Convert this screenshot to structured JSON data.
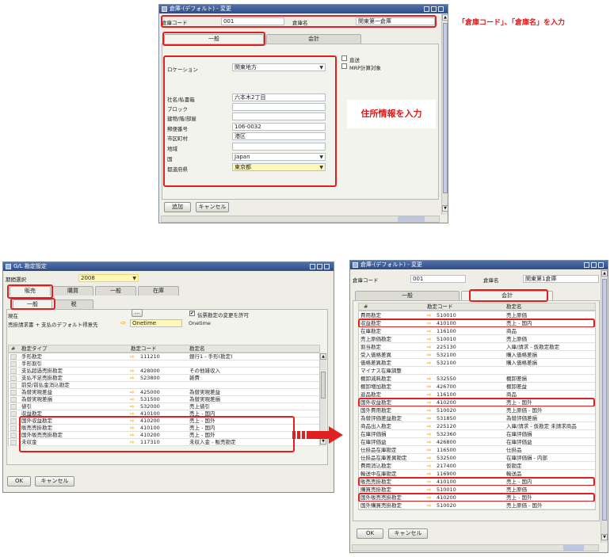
{
  "w1": {
    "title": "倉庫-(デフォルト) - 変更",
    "code_label": "倉庫コード",
    "code_value": "001",
    "name_label": "倉庫名",
    "name_value": "関東第一倉庫",
    "tab_general": "一般",
    "tab_accounting": "会計",
    "location_label": "ロケーション",
    "location_value": "関東地方",
    "chk1": "直送",
    "chk2": "MRP計算対象",
    "fields": [
      {
        "label": "社名/私書箱",
        "value": "六本木2丁目"
      },
      {
        "label": "ブロック",
        "value": ""
      },
      {
        "label": "建物/階/部屋",
        "value": ""
      },
      {
        "label": "郵便番号",
        "value": "106-0032"
      },
      {
        "label": "市区町村",
        "value": "港区"
      },
      {
        "label": "地域",
        "value": ""
      },
      {
        "label": "国",
        "value": "Japan"
      },
      {
        "label": "都道府県",
        "value": "東京都"
      }
    ],
    "add_btn": "追加",
    "cancel_btn": "キャンセル"
  },
  "ann1": "「倉庫コード」、「倉庫名」を入力",
  "ann2": "住所情報を入力",
  "w2": {
    "title": "G/L 勘定設定",
    "period_label": "期間選択",
    "period_value": "2008",
    "tabs": [
      "販売",
      "購買",
      "一般",
      "在庫"
    ],
    "subtabs": [
      "一般",
      "税"
    ],
    "filter_label": "現在",
    "filter_btn": "...",
    "chk_label": "伝票勘定の変更を許可",
    "dflt_label": "売掛請求書 + 支払のデフォルト得意先",
    "dflt_value": "Onetime",
    "dflt_value2": "Onetime",
    "col_type": "勘定タイプ",
    "col_code": "勘定コード",
    "col_name": "勘定名",
    "rows": [
      {
        "type": "手形勘定",
        "code": "111210",
        "name": "銀行1 - 手形(勘定)"
      },
      {
        "type": "手形割引",
        "code": "",
        "name": ""
      },
      {
        "type": "支払超過売掛勘定",
        "code": "428000",
        "name": "その他雑収入"
      },
      {
        "type": "支払不足売掛勘定",
        "code": "523800",
        "name": "雑費"
      },
      {
        "type": "前受/前払金消込勘定",
        "code": "",
        "name": ""
      },
      {
        "type": "為替実現差益",
        "code": "425000",
        "name": "為替実現差益"
      },
      {
        "type": "為替実現差損",
        "code": "531500",
        "name": "為替実現差損"
      },
      {
        "type": "値引",
        "code": "532000",
        "name": "売上値引"
      },
      {
        "type": "収益勘定",
        "code": "410100",
        "name": "売上 - 国内"
      },
      {
        "type": "国外収益勘定",
        "code": "410200",
        "name": "売上 - 国外"
      },
      {
        "type": "販売売掛勘定",
        "code": "410100",
        "name": "売上 - 国内"
      },
      {
        "type": "国外販売売掛勘定",
        "code": "410200",
        "name": "売上 - 国外"
      },
      {
        "type": "未収金",
        "code": "117310",
        "name": "未収入金 - 販売勘定"
      }
    ],
    "ok_btn": "OK",
    "cancel_btn": "キャンセル"
  },
  "w3": {
    "title": "倉庫-(デフォルト) - 変更",
    "code_label": "倉庫コード",
    "code_value": "001",
    "name_label": "倉庫名",
    "name_value": "関東第1倉庫",
    "tab_general": "一般",
    "tab_accounting": "会計",
    "col_num": "#",
    "col_code": "勘定コード",
    "col_name": "勘定名",
    "rows": [
      {
        "type": "費用勘定",
        "code": "510010",
        "name": "売上原価"
      },
      {
        "type": "収益勘定",
        "code": "410100",
        "name": "売上 - 国内"
      },
      {
        "type": "在庫勘定",
        "code": "116100",
        "name": "商品"
      },
      {
        "type": "売上原価勘定",
        "code": "510010",
        "name": "売上原価"
      },
      {
        "type": "割当勘定",
        "code": "225130",
        "name": "入庫/請求 - 仮勘定勘定"
      },
      {
        "type": "受入価格差異",
        "code": "532100",
        "name": "購入価格差損"
      },
      {
        "type": "価格差異勘定",
        "code": "532100",
        "name": "購入価格差損"
      },
      {
        "type": "マイナス在庫調整",
        "code": "",
        "name": ""
      },
      {
        "type": "棚卸減耗勘定",
        "code": "532550",
        "name": "棚卸差損"
      },
      {
        "type": "棚卸増加勘定",
        "code": "426700",
        "name": "棚卸差益"
      },
      {
        "type": "返品勘定",
        "code": "116100",
        "name": "商品"
      },
      {
        "type": "国外収益勘定",
        "code": "410200",
        "name": "売上 - 国外"
      },
      {
        "type": "国外費用勘定",
        "code": "510020",
        "name": "売上原価 - 国外"
      },
      {
        "type": "為替評価差益勘定",
        "code": "531850",
        "name": "為替評価差損"
      },
      {
        "type": "商品出入勘定",
        "code": "225120",
        "name": "入庫/請求 - 仮勘定 未請求商品"
      },
      {
        "type": "在庫評価損",
        "code": "532360",
        "name": "在庫評価損"
      },
      {
        "type": "在庫評価益",
        "code": "426800",
        "name": "在庫評価益"
      },
      {
        "type": "仕掛品在庫勘定",
        "code": "116500",
        "name": "仕掛品"
      },
      {
        "type": "仕掛品在庫差異勘定",
        "code": "532500",
        "name": "在庫評価損 - 内部"
      },
      {
        "type": "費用消込勘定",
        "code": "217400",
        "name": "仮勘定"
      },
      {
        "type": "輸送中在庫勘定",
        "code": "116900",
        "name": "輸送品"
      },
      {
        "type": "販売売掛勘定",
        "code": "410100",
        "name": "売上 - 国内"
      },
      {
        "type": "購買売掛勘定",
        "code": "510010",
        "name": "売上原価"
      },
      {
        "type": "国外販売売掛勘定",
        "code": "410200",
        "name": "売上 - 国外"
      },
      {
        "type": "国外購買売掛勘定",
        "code": "510020",
        "name": "売上原価 - 国外"
      }
    ],
    "ok_btn": "OK",
    "cancel_btn": "キャンセル"
  },
  "colors": {
    "highlight": "#e02020",
    "annotation": "#e01818",
    "arrow": "#e02020",
    "titlebar": "#3a5890"
  },
  "icons": [
    "window-icon",
    "minimize-icon",
    "maximize-icon",
    "close-icon",
    "dropdown-arrow-icon",
    "account-link-arrow-icon",
    "big-right-arrow-icon"
  ]
}
